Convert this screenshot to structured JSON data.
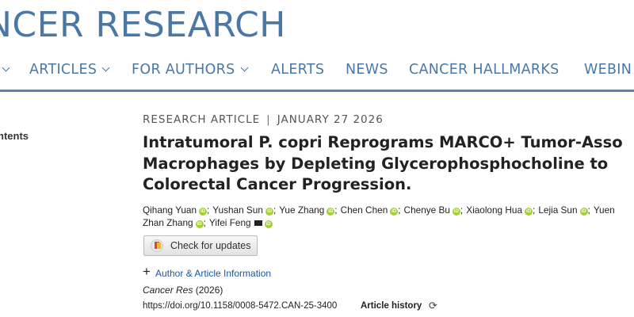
{
  "site": {
    "logo_text": "NCER RESEARCH"
  },
  "nav": {
    "items": [
      {
        "label": "",
        "has_dropdown": true
      },
      {
        "label": "ARTICLES",
        "has_dropdown": true
      },
      {
        "label": "FOR AUTHORS",
        "has_dropdown": true
      },
      {
        "label": "ALERTS",
        "has_dropdown": false
      },
      {
        "label": "NEWS",
        "has_dropdown": false
      },
      {
        "label": "CANCER HALLMARKS",
        "has_dropdown": false
      },
      {
        "label": "WEBIN",
        "has_dropdown": false
      }
    ]
  },
  "sidebar": {
    "contents_label": "ntents"
  },
  "article": {
    "type": "RESEARCH ARTICLE",
    "separator": "|",
    "date": "JANUARY 27 2026",
    "title_lines": [
      "Intratumoral P. copri Reprograms MARCO+ Tumor-Asso",
      "Macrophages by Depleting Glycerophosphocholine to",
      "Colorectal Cancer Progression."
    ],
    "authors_line1": [
      {
        "name": "Qihang Yuan",
        "orcid": true
      },
      {
        "name": "Yushan Sun",
        "orcid": true
      },
      {
        "name": "Yue Zhang",
        "orcid": true
      },
      {
        "name": "Chen Chen",
        "orcid": true
      },
      {
        "name": "Chenye Bu",
        "orcid": true
      },
      {
        "name": "Xiaolong Hua",
        "orcid": true
      },
      {
        "name": "Lejia Sun",
        "orcid": true
      },
      {
        "name": "Yuen",
        "orcid": false
      }
    ],
    "authors_line2": [
      {
        "name": "Zhan Zhang",
        "orcid": true,
        "mail": false
      },
      {
        "name": "Yifei Feng",
        "orcid": true,
        "mail": true
      }
    ],
    "author_separator": ";",
    "check_updates_label": "Check for updates",
    "author_info_plus": "+",
    "author_info_label": "Author & Article Information",
    "journal_name": "Cancer Res",
    "journal_year": "(2026)",
    "doi": "https://doi.org/10.1158/0008-5472.CAN-25-3400",
    "history_label": "Article history",
    "history_icon": "⟳"
  },
  "colors": {
    "brand": "#4a77a5",
    "link": "#1a56a0",
    "orcid": "#a6ce39"
  }
}
